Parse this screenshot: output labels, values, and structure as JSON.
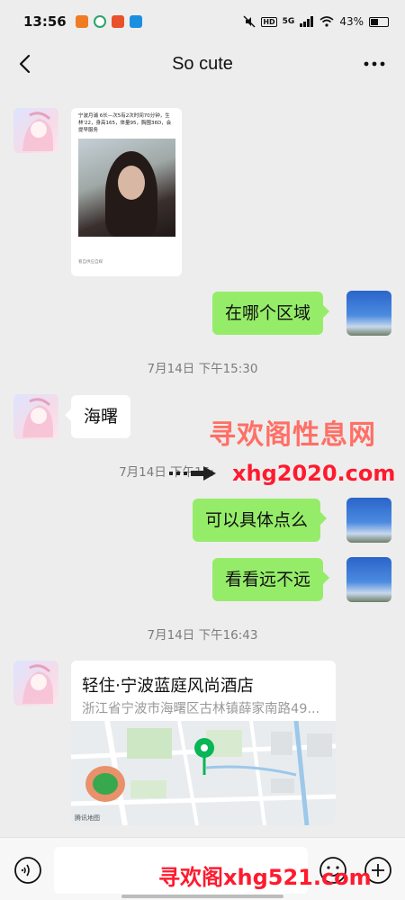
{
  "status_bar": {
    "time": "13:56",
    "battery": "43%",
    "network": "5G",
    "hd": "HD"
  },
  "header": {
    "title": "So cute"
  },
  "messages": {
    "card_text": "宁波月浦 6长—次5有2次时间70分钟，生林'22，身高165，体量95，胸围36D，会提早服务",
    "card_footer": "看自供应自媒",
    "out1": "在哪个区域",
    "ts1": "7月14日 下午15:30",
    "in1": "海曙",
    "ts2_visible": "7月14日 下午15:",
    "ts2_tail": "4",
    "out2": "可以具体点么",
    "out3": "看看远不远",
    "ts3": "7月14日 下午16:43",
    "location": {
      "name": "轻住·宁波蓝庭风尚酒店",
      "address": "浙江省宁波市海曙区古林镇薛家南路49...",
      "map_credit": "腾讯地图"
    }
  },
  "watermarks": {
    "cn": "寻欢阁性息网",
    "url1": "xhg2020.com",
    "bottom": "寻欢阁xhg521.com"
  },
  "colors": {
    "sent_bubble": "#95ec69",
    "received_bubble": "#ffffff",
    "background": "#ededed"
  }
}
